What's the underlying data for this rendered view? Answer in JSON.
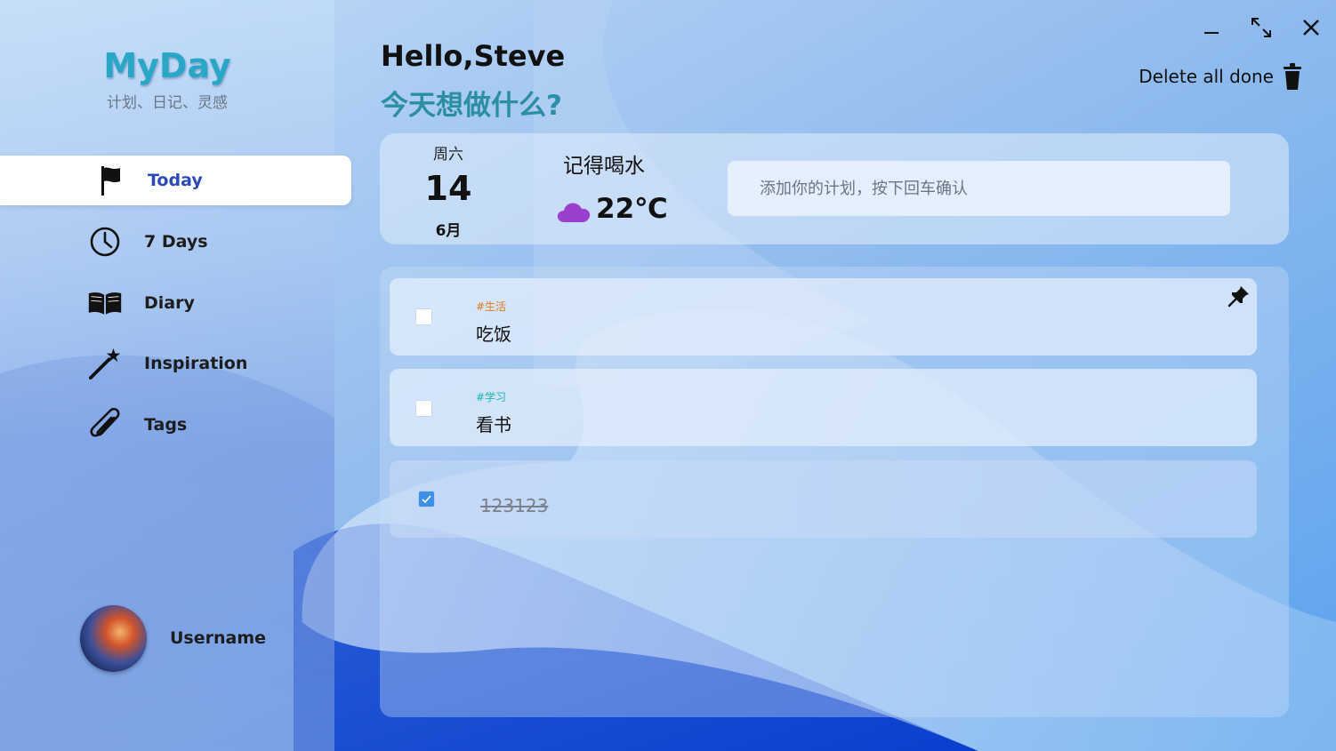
{
  "app": {
    "logo": "MyDay",
    "subtitle": "计划、日记、灵感"
  },
  "sidebar": {
    "items": [
      {
        "label": "Today",
        "icon": "flag-icon",
        "active": true
      },
      {
        "label": "7 Days",
        "icon": "clock-icon",
        "active": false
      },
      {
        "label": "Diary",
        "icon": "book-icon",
        "active": false
      },
      {
        "label": "Inspiration",
        "icon": "magic-wand-icon",
        "active": false
      },
      {
        "label": "Tags",
        "icon": "paperclip-icon",
        "active": false
      }
    ],
    "user": {
      "name": "Username"
    }
  },
  "header": {
    "greeting": "Hello,Steve",
    "question": "今天想做什么?",
    "delete_all_done": "Delete all done"
  },
  "info": {
    "weekday": "周六",
    "day": "14",
    "month": "6月",
    "reminder": "记得喝水",
    "temperature": "22℃",
    "weather_icon": "cloud-icon"
  },
  "input": {
    "placeholder": "添加你的计划，按下回车确认"
  },
  "tasks": [
    {
      "tag": "#生活",
      "tag_color": "#e07a1f",
      "title": "吃饭",
      "done": false,
      "pinned": true
    },
    {
      "tag": "#学习",
      "tag_color": "#18b5b5",
      "title": "看书",
      "done": false,
      "pinned": false
    },
    {
      "tag": "",
      "tag_color": "",
      "title": "123123",
      "done": true,
      "pinned": false
    }
  ],
  "colors": {
    "accent": "#2aa7c6",
    "question": "#2b8ea3",
    "active_nav": "#2b48b8",
    "check": "#3d8fe8"
  }
}
